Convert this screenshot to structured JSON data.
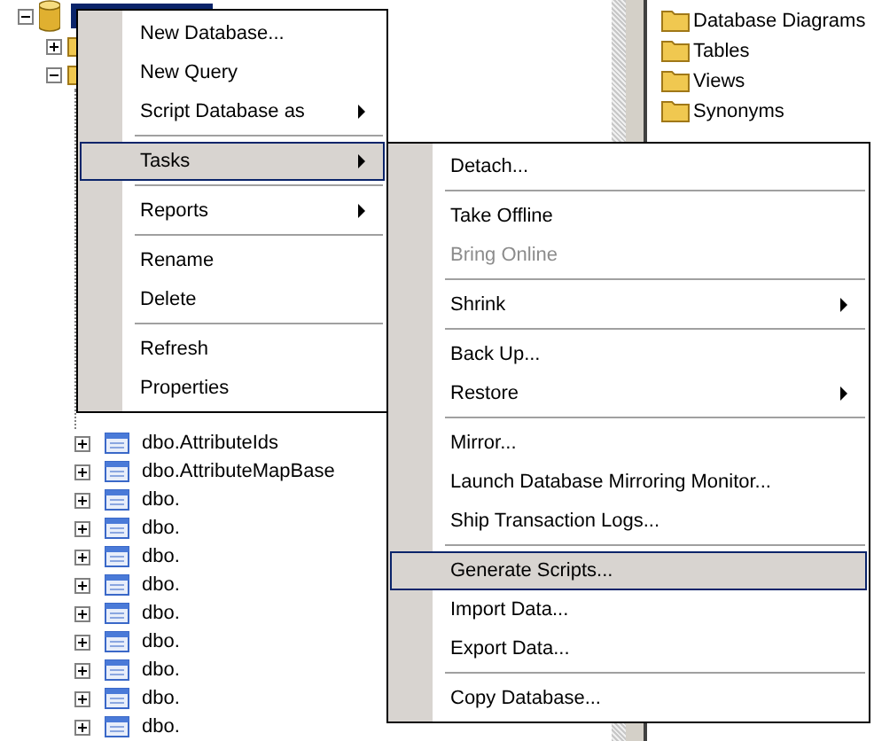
{
  "tree": {
    "root": {
      "expanded": true,
      "selected": true
    },
    "folders": [
      {
        "expanded": false
      },
      {
        "expanded": true
      }
    ],
    "tables": [
      {
        "label": "dbo.AttributeIds",
        "expanded": false
      },
      {
        "label": "dbo.AttributeMapBase",
        "expanded": false
      },
      {
        "label": "dbo.",
        "expanded": false
      },
      {
        "label": "dbo.",
        "expanded": false
      },
      {
        "label": "dbo.",
        "expanded": false
      },
      {
        "label": "dbo.",
        "expanded": false
      },
      {
        "label": "dbo.",
        "expanded": false
      },
      {
        "label": "dbo.",
        "expanded": false
      },
      {
        "label": "dbo.",
        "expanded": false
      },
      {
        "label": "dbo.",
        "expanded": false
      },
      {
        "label": "dbo.",
        "expanded": false
      }
    ]
  },
  "object_list": [
    "Database Diagrams",
    "Tables",
    "Views",
    "Synonyms"
  ],
  "context_menu": {
    "items": [
      {
        "kind": "item",
        "label": "New Database...",
        "submenu": false,
        "selected": false,
        "disabled": false
      },
      {
        "kind": "item",
        "label": "New Query",
        "submenu": false,
        "selected": false,
        "disabled": false
      },
      {
        "kind": "item",
        "label": "Script Database as",
        "submenu": true,
        "selected": false,
        "disabled": false
      },
      {
        "kind": "separator"
      },
      {
        "kind": "item",
        "label": "Tasks",
        "submenu": true,
        "selected": true,
        "disabled": false
      },
      {
        "kind": "separator"
      },
      {
        "kind": "item",
        "label": "Reports",
        "submenu": true,
        "selected": false,
        "disabled": false
      },
      {
        "kind": "separator"
      },
      {
        "kind": "item",
        "label": "Rename",
        "submenu": false,
        "selected": false,
        "disabled": false
      },
      {
        "kind": "item",
        "label": "Delete",
        "submenu": false,
        "selected": false,
        "disabled": false
      },
      {
        "kind": "separator"
      },
      {
        "kind": "item",
        "label": "Refresh",
        "submenu": false,
        "selected": false,
        "disabled": false
      },
      {
        "kind": "item",
        "label": "Properties",
        "submenu": false,
        "selected": false,
        "disabled": false
      }
    ]
  },
  "tasks_submenu": {
    "items": [
      {
        "kind": "item",
        "label": "Detach...",
        "submenu": false,
        "selected": false,
        "disabled": false
      },
      {
        "kind": "separator"
      },
      {
        "kind": "item",
        "label": "Take Offline",
        "submenu": false,
        "selected": false,
        "disabled": false
      },
      {
        "kind": "item",
        "label": "Bring Online",
        "submenu": false,
        "selected": false,
        "disabled": true
      },
      {
        "kind": "separator"
      },
      {
        "kind": "item",
        "label": "Shrink",
        "submenu": true,
        "selected": false,
        "disabled": false
      },
      {
        "kind": "separator"
      },
      {
        "kind": "item",
        "label": "Back Up...",
        "submenu": false,
        "selected": false,
        "disabled": false
      },
      {
        "kind": "item",
        "label": "Restore",
        "submenu": true,
        "selected": false,
        "disabled": false
      },
      {
        "kind": "separator"
      },
      {
        "kind": "item",
        "label": "Mirror...",
        "submenu": false,
        "selected": false,
        "disabled": false
      },
      {
        "kind": "item",
        "label": "Launch Database Mirroring Monitor...",
        "submenu": false,
        "selected": false,
        "disabled": false
      },
      {
        "kind": "item",
        "label": "Ship Transaction Logs...",
        "submenu": false,
        "selected": false,
        "disabled": false
      },
      {
        "kind": "separator"
      },
      {
        "kind": "item",
        "label": "Generate Scripts...",
        "submenu": false,
        "selected": true,
        "disabled": false
      },
      {
        "kind": "item",
        "label": "Import Data...",
        "submenu": false,
        "selected": false,
        "disabled": false
      },
      {
        "kind": "item",
        "label": "Export Data...",
        "submenu": false,
        "selected": false,
        "disabled": false
      },
      {
        "kind": "separator"
      },
      {
        "kind": "item",
        "label": "Copy Database...",
        "submenu": false,
        "selected": false,
        "disabled": false
      }
    ]
  }
}
